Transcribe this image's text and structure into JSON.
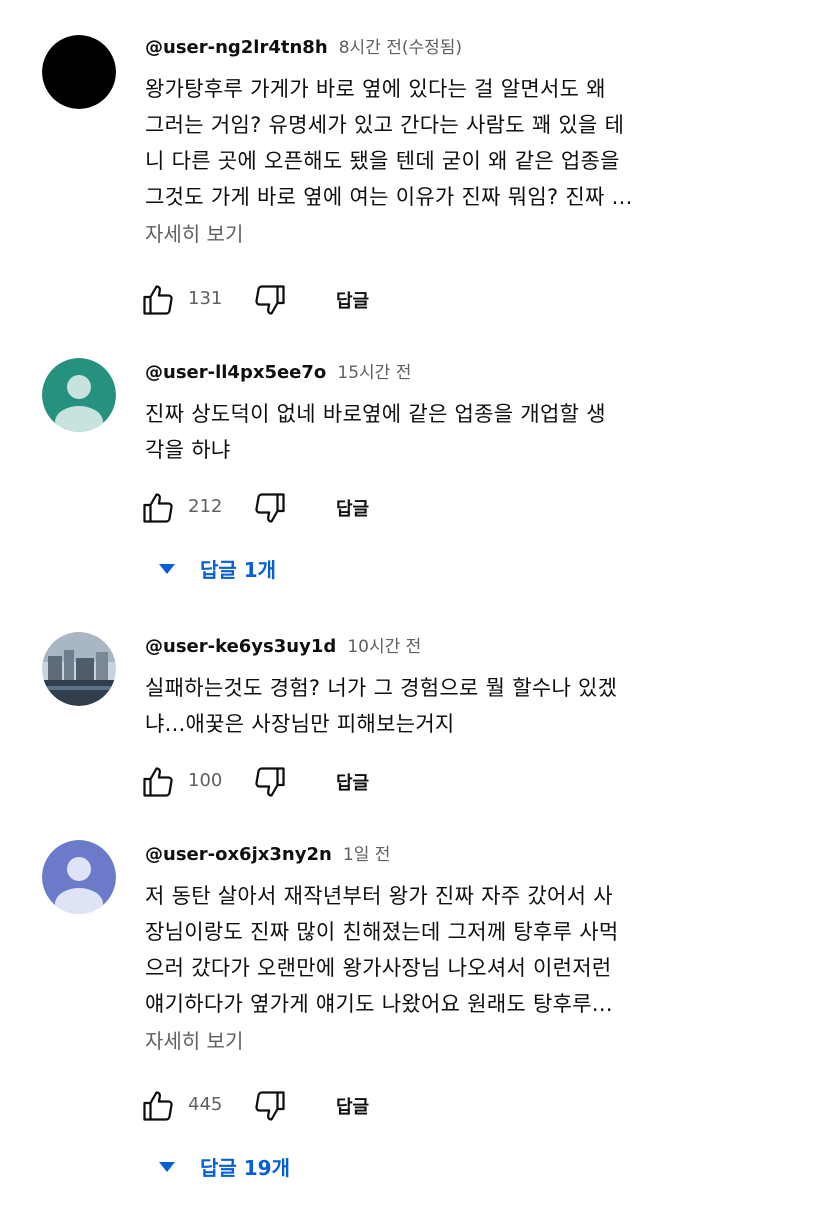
{
  "comments": [
    {
      "handle": "@user-ng2lr4tn8h",
      "time": "8시간 전(수정됨)",
      "avatar_color": "#000000",
      "text": "왕가탕후루 가게가 바로 옆에 있다는 걸 알면서도 왜\n그러는 거임? 유명세가 있고 간다는 사람도 꽤 있을 테\n니 다른 곳에 오픈해도 됐을 텐데 굳이 왜 같은 업종을\n그것도 가게 바로 옆에 여는 이유가 진짜 뭐임? 진짜 ...",
      "more": "자세히 보기",
      "likes": "131",
      "reply": "답글"
    },
    {
      "handle": "@user-ll4px5ee7o",
      "time": "15시간 전",
      "avatar_color": "#26917f",
      "text": "진짜 상도덕이 없네 바로옆에 같은 업종을 개업할 생\n각을 하냐",
      "likes": "212",
      "reply": "답글",
      "replies_label": "답글 1개"
    },
    {
      "handle": "@user-ke6ys3uy1d",
      "time": "10시간 전",
      "avatar_color": "#8a97a6",
      "text": "실패하는것도 경험? 너가 그 경험으로 뭘 할수나 있겠\n냐...애꿎은 사장님만 피해보는거지",
      "likes": "100",
      "reply": "답글"
    },
    {
      "handle": "@user-ox6jx3ny2n",
      "time": "1일 전",
      "avatar_color": "#6c7bc9",
      "text": "저 동탄 살아서 재작년부터 왕가 진짜 자주 갔어서 사\n장님이랑도 진짜 많이 친해졌는데 그저께 탕후루 사먹\n으러 갔다가 오랜만에 왕가사장님 나오셔서 이런저런\n얘기하다가 옆가게 얘기도 나왔어요 원래도 탕후루...",
      "more": "자세히 보기",
      "likes": "445",
      "reply": "답글",
      "replies_label": "답글 19개"
    }
  ],
  "colors": {
    "link_blue": "#065fd4",
    "secondary_text": "#606060"
  },
  "icons": {
    "like": "thumb-up-icon",
    "dislike": "thumb-down-icon",
    "expand": "caret-down-icon"
  }
}
